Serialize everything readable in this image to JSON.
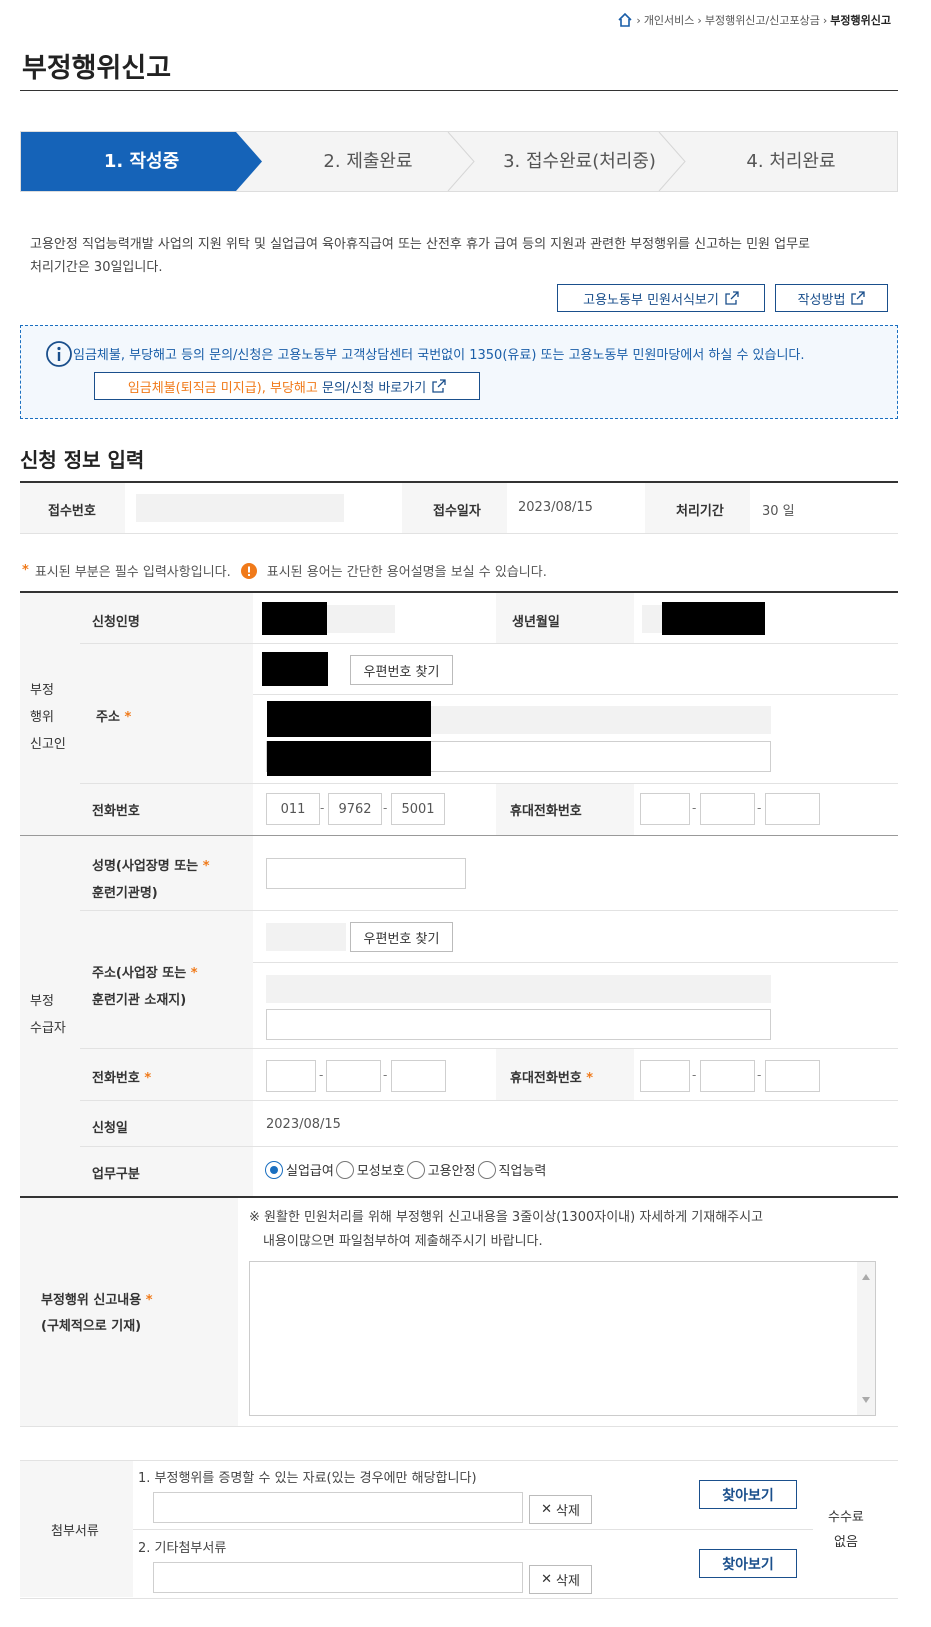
{
  "breadcrumb": {
    "items": [
      "개인서비스",
      "부정행위신고/신고포상금"
    ],
    "current": "부정행위신고"
  },
  "page_title": "부정행위신고",
  "steps": [
    "1. 작성중",
    "2. 제출완료",
    "3. 접수완료(처리중)",
    "4. 처리완료"
  ],
  "intro": {
    "line1": "고용안정 직업능력개발 사업의 지원 위탁 및 실업급여 육아휴직급여 또는 산전후 휴가 급여 등의 지원과 관련한 부정행위를 신고하는 민원 업무로",
    "line2": "처리기간은 30일입니다.",
    "btn_forms": "고용노동부 민원서식보기",
    "btn_howto": "작성방법"
  },
  "notice": {
    "text": "임금체불, 부당해고 등의 문의/신청은 고용노동부 고객상담센터 국번없이 1350(유료) 또는 고용노동부 민원마당에서 하실 수 있습니다.",
    "link_orange": "임금체불(퇴직금 미지급), 부당해고",
    "link_rest": " 문의/신청 바로가기"
  },
  "section_title": "신청 정보 입력",
  "receipt": {
    "no_label": "접수번호",
    "date_label": "접수일자",
    "date_value": "2023/08/15",
    "period_label": "처리기간",
    "period_value": "30 일"
  },
  "legend": {
    "required": "표시된 부분은 필수 입력사항입니다.",
    "term": "표시된 용어는 간단한 용어설명을 보실 수 있습니다."
  },
  "reporter": {
    "group": [
      "부정",
      "행위",
      "신고인"
    ],
    "name_label": "신청인명",
    "birth_label": "생년월일",
    "address_label": "주소",
    "zip_button": "우편번호 찾기",
    "phone_label": "전화번호",
    "phone": [
      "011",
      "9762",
      "5001"
    ],
    "mobile_label": "휴대전화번호"
  },
  "recipient": {
    "group": [
      "부정",
      "수급자"
    ],
    "name_label_1": "성명(사업장명 또는",
    "name_label_2": "훈련기관명)",
    "address_label_1": "주소(사업장 또는",
    "address_label_2": "훈련기관 소재지)",
    "zip_button": "우편번호 찾기",
    "phone_label": "전화번호",
    "mobile_label": "휴대전화번호",
    "date_label": "신청일",
    "date_value": "2023/08/15",
    "type_label": "업무구분",
    "types": [
      "실업급여",
      "모성보호",
      "고용안정",
      "직업능력"
    ],
    "selected": "실업급여"
  },
  "content": {
    "label_1": "부정행위 신고내용",
    "label_2": "(구체적으로 기재)",
    "hint_1": "※ 원활한 민원처리를 위해 부정행위 신고내용을 3줄이상(1300자이내) 자세하게 기재해주시고",
    "hint_2": "내용이많으면 파일첨부하여 제출해주시기 바랍니다."
  },
  "attach": {
    "label": "첨부서류",
    "item1": "1. 부정행위를 증명할 수 있는 자료(있는 경우에만 해당합니다)",
    "item2": "2. 기타첨부서류",
    "delete": "삭제",
    "browse": "찾아보기",
    "fee_1": "수수료",
    "fee_2": "없음"
  },
  "colors": {
    "primary": "#1a6fc0",
    "accent": "#f07a1a",
    "step_active": "#1563b8"
  }
}
